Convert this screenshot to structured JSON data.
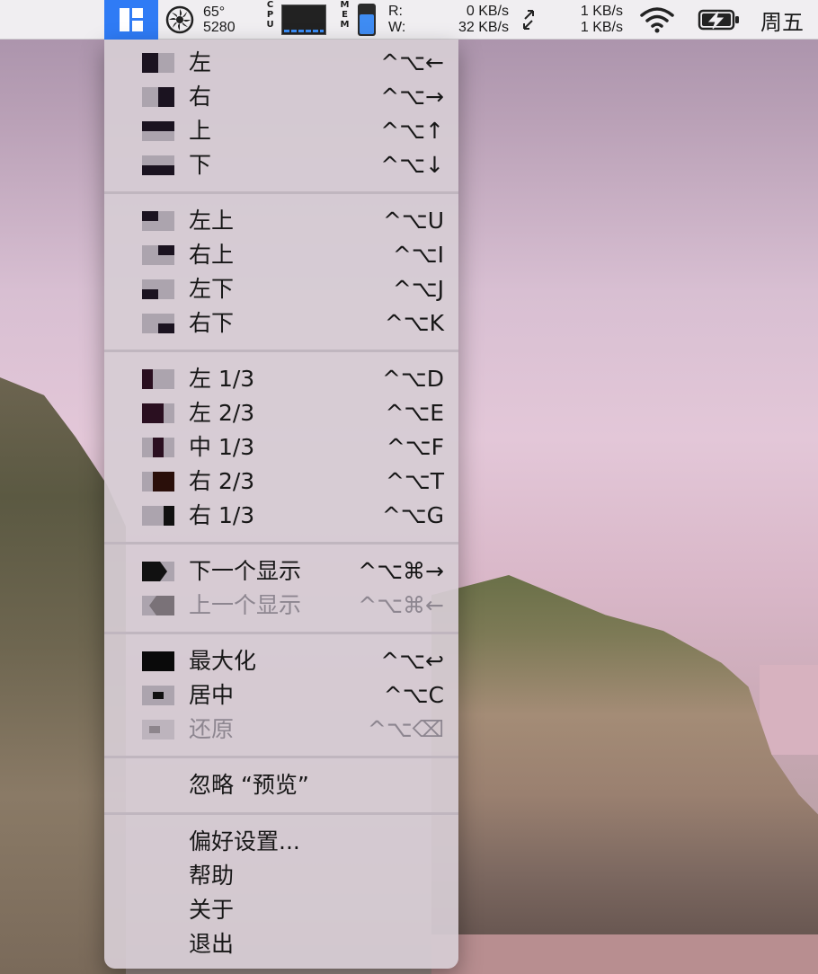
{
  "menubar": {
    "temperature": "65°",
    "fan_speed": "5280",
    "cpu_label": "CPU",
    "mem_label": "MEM",
    "mem_usage_fraction": 0.6,
    "net_read_label": "R:",
    "net_write_label": "W:",
    "net_read_value": "0 KB/s",
    "net_write_value": "32 KB/s",
    "net2_up": "1 KB/s",
    "net2_down": "1 KB/s",
    "clock": "周五",
    "icons": {
      "app": "rectangle-layout-icon",
      "fan": "fan-icon",
      "swap": "swap-arrows-icon",
      "wifi": "wifi-icon",
      "battery": "battery-charging-icon"
    },
    "accent_color": "#2f7bf5"
  },
  "menu": {
    "groups": [
      {
        "items": [
          {
            "label": "左",
            "shortcut": "^⌥←",
            "icon": "left-half-icon"
          },
          {
            "label": "右",
            "shortcut": "^⌥→",
            "icon": "right-half-icon"
          },
          {
            "label": "上",
            "shortcut": "^⌥↑",
            "icon": "top-half-icon"
          },
          {
            "label": "下",
            "shortcut": "^⌥↓",
            "icon": "bottom-half-icon"
          }
        ]
      },
      {
        "items": [
          {
            "label": "左上",
            "shortcut": "^⌥U",
            "icon": "top-left-icon"
          },
          {
            "label": "右上",
            "shortcut": "^⌥I",
            "icon": "top-right-icon"
          },
          {
            "label": "左下",
            "shortcut": "^⌥J",
            "icon": "bottom-left-icon"
          },
          {
            "label": "右下",
            "shortcut": "^⌥K",
            "icon": "bottom-right-icon"
          }
        ]
      },
      {
        "items": [
          {
            "label": "左 1/3",
            "shortcut": "^⌥D",
            "icon": "left-third-icon"
          },
          {
            "label": "左 2/3",
            "shortcut": "^⌥E",
            "icon": "left-two-thirds-icon"
          },
          {
            "label": "中 1/3",
            "shortcut": "^⌥F",
            "icon": "center-third-icon"
          },
          {
            "label": "右 2/3",
            "shortcut": "^⌥T",
            "icon": "right-two-thirds-icon"
          },
          {
            "label": "右 1/3",
            "shortcut": "^⌥G",
            "icon": "right-third-icon"
          }
        ]
      },
      {
        "items": [
          {
            "label": "下一个显示",
            "shortcut": "^⌥⌘→",
            "icon": "next-display-icon"
          },
          {
            "label": "上一个显示",
            "shortcut": "^⌥⌘←",
            "icon": "previous-display-icon",
            "disabled": true
          }
        ]
      },
      {
        "items": [
          {
            "label": "最大化",
            "shortcut": "^⌥↩",
            "icon": "maximize-icon"
          },
          {
            "label": "居中",
            "shortcut": "^⌥C",
            "icon": "center-icon"
          },
          {
            "label": "还原",
            "shortcut": "^⌥⌫",
            "icon": "restore-icon",
            "disabled": true
          }
        ]
      },
      {
        "items": [
          {
            "label": "忽略 “预览”"
          }
        ]
      },
      {
        "items": [
          {
            "label": "偏好设置..."
          },
          {
            "label": "帮助"
          },
          {
            "label": "关于"
          },
          {
            "label": "退出"
          }
        ]
      }
    ]
  }
}
